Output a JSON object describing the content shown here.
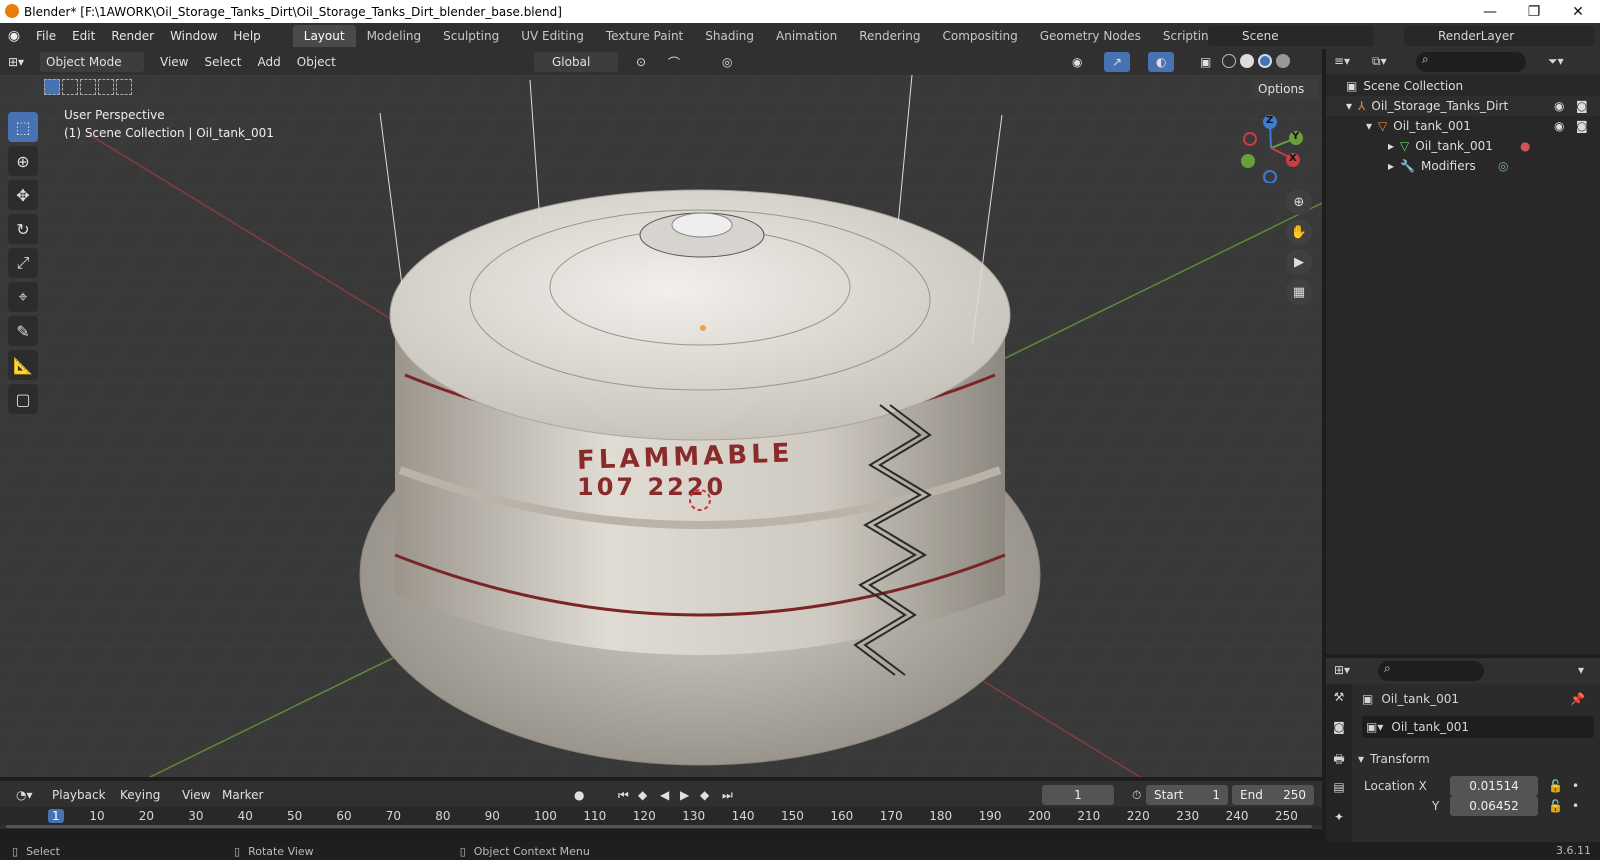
{
  "window": {
    "title": "Blender* [F:\\1AWORK\\Oil_Storage_Tanks_Dirt\\Oil_Storage_Tanks_Dirt_blender_base.blend]",
    "minimize": "—",
    "maximize": "❐",
    "close": "✕"
  },
  "menus": [
    "File",
    "Edit",
    "Render",
    "Window",
    "Help"
  ],
  "workspaces": [
    "Layout",
    "Modeling",
    "Sculpting",
    "UV Editing",
    "Texture Paint",
    "Shading",
    "Animation",
    "Rendering",
    "Compositing",
    "Geometry Nodes",
    "Scripting"
  ],
  "add_workspace": "+",
  "scene": {
    "name": "Scene",
    "render_layer": "RenderLayer"
  },
  "header3d": {
    "mode": "Object Mode",
    "menus": [
      "View",
      "Select",
      "Add",
      "Object"
    ],
    "orientation": "Global",
    "options": "Options"
  },
  "viewport": {
    "perspective": "User Perspective",
    "collection": "(1) Scene Collection | Oil_tank_001",
    "tank_text_line1": "FLAMMABLE",
    "tank_text_line2": "107   2220"
  },
  "gizmo": {
    "z": "Z",
    "y": "Y",
    "x": "X"
  },
  "outliner": {
    "items": [
      {
        "label": "Scene Collection"
      },
      {
        "label": "Oil_Storage_Tanks_Dirt"
      },
      {
        "label": "Oil_tank_001"
      },
      {
        "label": "Oil_tank_001"
      },
      {
        "label": "Modifiers"
      }
    ]
  },
  "properties": {
    "object_name": "Oil_tank_001",
    "data_name": "Oil_tank_001",
    "section": "Transform",
    "location_x_label": "Location X",
    "location_x": "0.01514",
    "location_y_label": "Y",
    "location_y": "0.06452"
  },
  "timeline": {
    "menus": [
      "Playback",
      "Keying",
      "View",
      "Marker"
    ],
    "current_frame": "1",
    "start_label": "Start",
    "start": "1",
    "end_label": "End",
    "end": "250",
    "ticks": [
      "1",
      "10",
      "20",
      "30",
      "40",
      "50",
      "60",
      "70",
      "80",
      "90",
      "100",
      "110",
      "120",
      "130",
      "140",
      "150",
      "160",
      "170",
      "180",
      "190",
      "200",
      "210",
      "220",
      "230",
      "240",
      "250"
    ]
  },
  "status": {
    "select": "Select",
    "rotate": "Rotate View",
    "context": "Object Context Menu",
    "version": "3.6.11"
  },
  "colors": {
    "accent": "#4772b3",
    "x_axis": "#c83d43",
    "y_axis": "#6aa03a",
    "z_axis": "#3b7bd6",
    "tank_text": "#8a2a2a"
  }
}
